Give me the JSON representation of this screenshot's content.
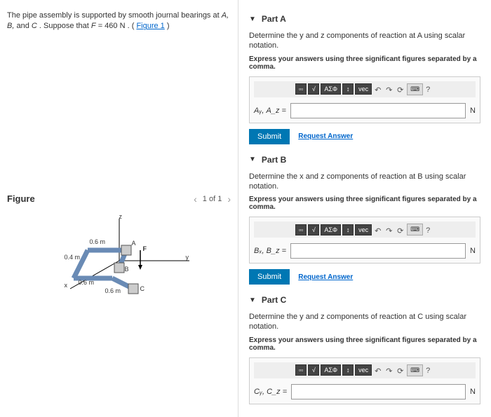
{
  "problem": {
    "text_prefix": "The pipe assembly is supported by smooth journal bearings at ",
    "points": "A, B,",
    "text_mid": " and ",
    "point_c": "C",
    "text_suppose": ". Suppose that ",
    "force_var": "F",
    "force_eq": " = 460 N . (",
    "figure_link": "Figure 1",
    "close": ")"
  },
  "figure": {
    "title": "Figure",
    "nav_prev": "‹",
    "nav_next": "›",
    "count": "1 of 1",
    "labels": {
      "z": "z",
      "y": "y",
      "x": "x",
      "A": "A",
      "B": "B",
      "C": "C",
      "F": "F",
      "d1": "0.6 m",
      "d2": "0.4 m",
      "d3": "0.6 m",
      "d4": "0.6 m"
    }
  },
  "toolbar_labels": {
    "templates": "▫▫",
    "sqrt": "√",
    "greek": "ΑΣΦ",
    "subsup": "↕",
    "vec": "vec",
    "undo": "↶",
    "redo": "↷",
    "reset": "⟳",
    "keyboard": "⌨",
    "help": "?"
  },
  "parts": {
    "A": {
      "header": "Part A",
      "prompt": "Determine the y and z components of reaction at A using scalar notation.",
      "instruction": "Express your answers using three significant figures separated by a comma.",
      "var_label": "Aᵧ, A_z =",
      "unit": "N",
      "submit": "Submit",
      "request": "Request Answer"
    },
    "B": {
      "header": "Part B",
      "prompt": "Determine the x and z components of reaction at B using scalar notation.",
      "instruction": "Express your answers using three significant figures separated by a comma.",
      "var_label": "Bₓ, B_z =",
      "unit": "N",
      "submit": "Submit",
      "request": "Request Answer"
    },
    "C": {
      "header": "Part C",
      "prompt": "Determine the y and z components of reaction at C using scalar notation.",
      "instruction": "Express your answers using three significant figures separated by a comma.",
      "var_label": "Cᵧ, C_z =",
      "unit": "N",
      "submit": "Submit",
      "request": "Request Answer"
    }
  }
}
